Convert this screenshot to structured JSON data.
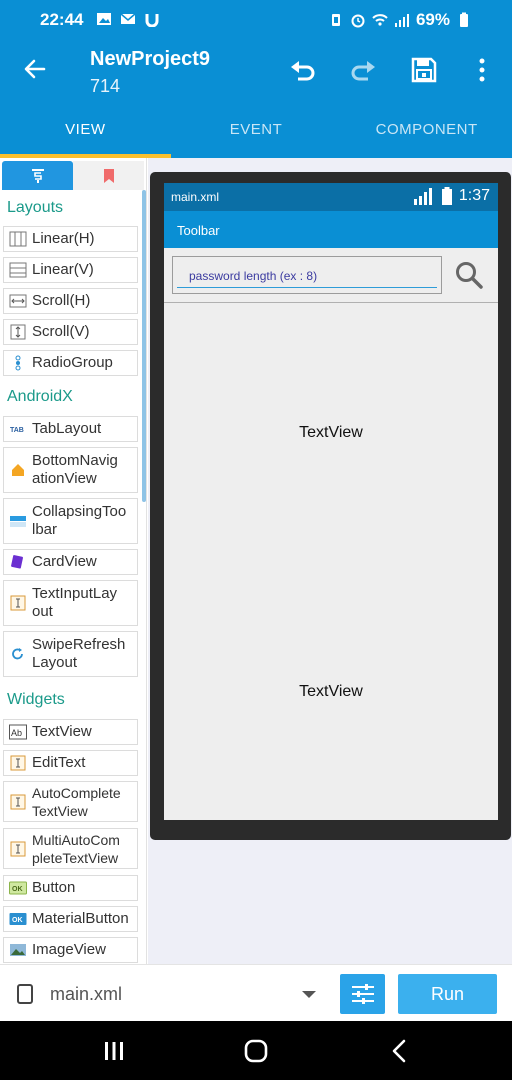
{
  "status_bar": {
    "time": "22:44",
    "battery": "69%"
  },
  "app_bar": {
    "title": "NewProject9",
    "subtitle": "714"
  },
  "tabs": [
    {
      "label": "VIEW",
      "active": true
    },
    {
      "label": "EVENT",
      "active": false
    },
    {
      "label": "COMPONENT",
      "active": false
    }
  ],
  "palette": {
    "sections": {
      "layouts": "Layouts",
      "androidx": "AndroidX",
      "widgets": "Widgets"
    },
    "layouts": [
      "Linear(H)",
      "Linear(V)",
      "Scroll(H)",
      "Scroll(V)",
      "RadioGroup"
    ],
    "androidx": [
      "TabLayout",
      "BottomNavig\nationView",
      "CollapsingToo\nlbar",
      "CardView",
      "TextInputLay\nout",
      "SwipeRefresh\nLayout"
    ],
    "widgets": [
      "TextView",
      "EditText",
      "AutoComplete\nTextView",
      "MultiAutoCom\npleteTextView",
      "Button",
      "MaterialButton",
      "ImageView"
    ]
  },
  "preview": {
    "file": "main.xml",
    "time": "1:37",
    "toolbar_title": "Toolbar",
    "edit_hint": "password length (ex : 8)",
    "textview_1": "TextView",
    "textview_2": "TextView"
  },
  "bottom_bar": {
    "file": "main.xml",
    "run_label": "Run"
  },
  "colors": {
    "primary": "#0a8fd4",
    "accent": "#fbc02d",
    "section": "#1b9a8a"
  }
}
